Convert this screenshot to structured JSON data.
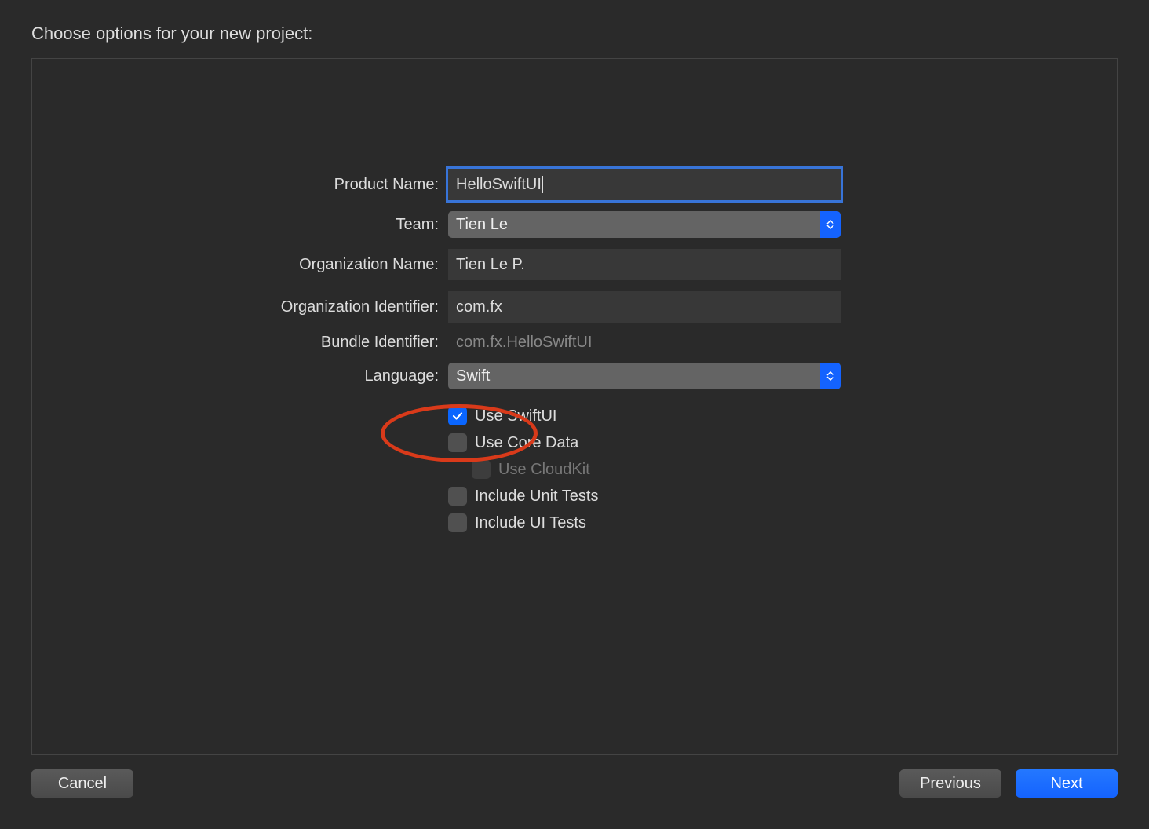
{
  "title": "Choose options for your new project:",
  "form": {
    "productName": {
      "label": "Product Name:",
      "value": "HelloSwiftUI"
    },
    "team": {
      "label": "Team:",
      "value": "Tien Le"
    },
    "orgName": {
      "label": "Organization Name:",
      "value": "Tien Le P."
    },
    "orgIdentifier": {
      "label": "Organization Identifier:",
      "value": "com.fx"
    },
    "bundleIdentifier": {
      "label": "Bundle Identifier:",
      "value": "com.fx.HelloSwiftUI"
    },
    "language": {
      "label": "Language:",
      "value": "Swift"
    },
    "useSwiftUI": {
      "label": "Use SwiftUI",
      "checked": true
    },
    "useCoreData": {
      "label": "Use Core Data",
      "checked": false
    },
    "useCloudKit": {
      "label": "Use CloudKit",
      "checked": false,
      "disabled": true
    },
    "includeUnitTests": {
      "label": "Include Unit Tests",
      "checked": false
    },
    "includeUITests": {
      "label": "Include UI Tests",
      "checked": false
    }
  },
  "buttons": {
    "cancel": "Cancel",
    "previous": "Previous",
    "next": "Next"
  }
}
